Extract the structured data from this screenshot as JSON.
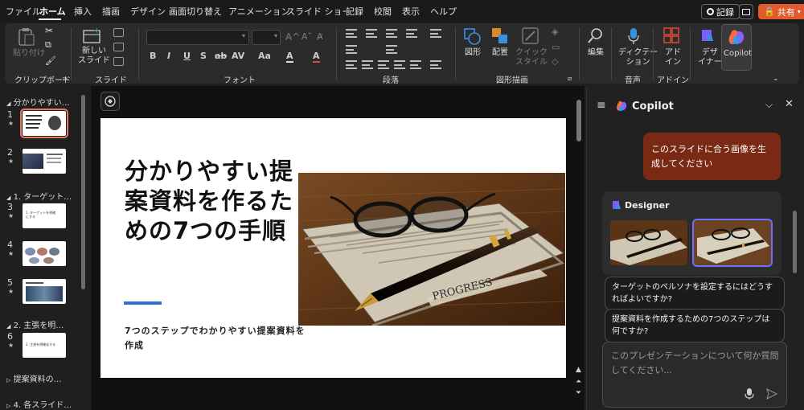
{
  "menu": {
    "items": [
      "ファイル",
      "ホーム",
      "挿入",
      "描画",
      "デザイン",
      "画面切り替え",
      "アニメーション",
      "スライド ショー",
      "記録",
      "校閲",
      "表示",
      "ヘルプ"
    ],
    "record_label": "記録",
    "share_label": "共有"
  },
  "ribbon": {
    "clipboard": {
      "paste_label": "貼り付け",
      "group_label": "クリップボード"
    },
    "slides": {
      "new_slide_label": "新しい\nスライド",
      "group_label": "スライド"
    },
    "font": {
      "group_label": "フォント",
      "format_buttons": [
        "B",
        "I",
        "U",
        "S",
        "ab",
        "AV",
        "Aa",
        "A"
      ]
    },
    "paragraph": {
      "group_label": "段落"
    },
    "drawing": {
      "shapes_label": "図形",
      "arrange_label": "配置",
      "quick_styles_label": "クイック\nスタイル",
      "group_label": "図形描画"
    },
    "editing": {
      "edit_label": "編集"
    },
    "voice": {
      "dictate_label": "ディクテー\nション",
      "group_label": "音声"
    },
    "addins": {
      "addin_label": "アド\nイン",
      "group_label": "アドイン"
    },
    "designer": {
      "label": "デザ\nイナー"
    },
    "copilot": {
      "label": "Copilot"
    }
  },
  "slides_panel": {
    "sections": [
      {
        "label": "分かりやすい…",
        "caret": "◢"
      },
      {
        "label": "1. ターゲット…",
        "caret": "◢"
      },
      {
        "label": "2. 主張を明…",
        "caret": "◢"
      },
      {
        "label": "提案資料の…",
        "caret": "▷"
      },
      {
        "label": "4. 各スライド…",
        "caret": "▷"
      }
    ],
    "slides": [
      {
        "number": "1",
        "star": "★"
      },
      {
        "number": "2",
        "star": "★"
      },
      {
        "number": "3",
        "star": "★"
      },
      {
        "number": "4",
        "star": "★"
      },
      {
        "number": "5",
        "star": "★"
      },
      {
        "number": "6",
        "star": "★"
      }
    ],
    "thumb_texts": {
      "t3": "1. ターゲットを明確\nにする",
      "t6": "2. 主張を明確化する"
    }
  },
  "slide": {
    "title": "分かりやすい提案資料を作るための7つの手順",
    "subtitle": "7つのステップでわかりやすい提案資料を作成",
    "image_caption": "PROGRESS"
  },
  "copilot": {
    "title": "Copilot",
    "user_message": "このスライドに合う画像を生成してください",
    "designer_title": "Designer",
    "suggestions": [
      "ターゲットのペルソナを設定するにはどうすればよいですか?",
      "提案資料を作成するための7つのステップは何ですか?"
    ],
    "input_placeholder": "このプレゼンテーションについて何か質問してください..."
  },
  "colors": {
    "accent_blue": "#2f6fd6",
    "user_bubble": "#7a2a14",
    "selected_thumb": "#e57a5f",
    "share_button": "#e05a2b"
  }
}
